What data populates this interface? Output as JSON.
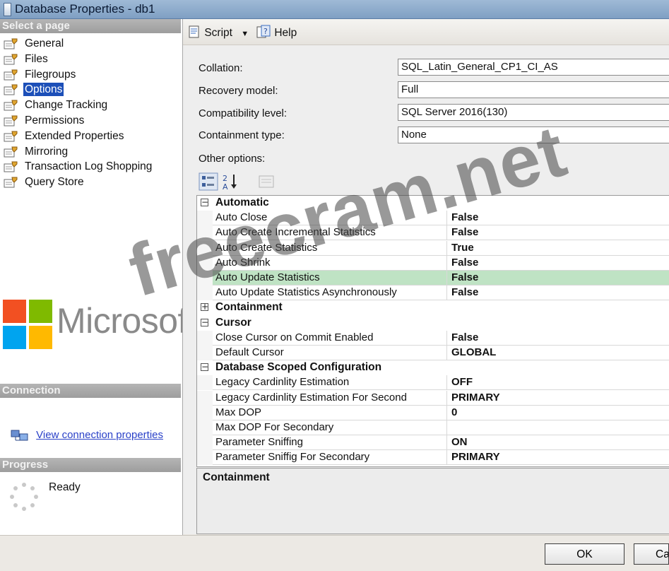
{
  "window": {
    "title": "Database Properties - db1"
  },
  "left_pane": {
    "select_page_header": "Select a page",
    "pages": [
      {
        "label": "General",
        "selected": false
      },
      {
        "label": "Files",
        "selected": false
      },
      {
        "label": "Filegroups",
        "selected": false
      },
      {
        "label": "Options",
        "selected": true
      },
      {
        "label": "Change Tracking",
        "selected": false
      },
      {
        "label": "Permissions",
        "selected": false
      },
      {
        "label": "Extended Properties",
        "selected": false
      },
      {
        "label": "Mirroring",
        "selected": false
      },
      {
        "label": "Transaction Log Shopping",
        "selected": false
      },
      {
        "label": "Query Store",
        "selected": false
      }
    ],
    "logo_text": "Microsoft",
    "logo_colors": [
      "#f25022",
      "#7fba00",
      "#00a4ef",
      "#ffb900"
    ],
    "connection_header": "Connection",
    "connection_link": "View connection properties",
    "progress_header": "Progress",
    "progress_status": "Ready"
  },
  "toolbar": {
    "script_label": "Script",
    "help_label": "Help"
  },
  "form": {
    "collation_label": "Collation:",
    "collation_value": "SQL_Latin_General_CP1_CI_AS",
    "recovery_label": "Recovery model:",
    "recovery_value": "Full",
    "compat_label": "Compatibility level:",
    "compat_value": "SQL Server 2016(130)",
    "containment_label": "Containment type:",
    "containment_value": "None",
    "other_options_label": "Other options:"
  },
  "grid": {
    "rows": [
      {
        "kind": "category",
        "label": "Automatic",
        "expanded": true
      },
      {
        "kind": "property",
        "name": "Auto Close",
        "value": "False"
      },
      {
        "kind": "property",
        "name": "Auto Create Incremental Statistics",
        "value": "False"
      },
      {
        "kind": "property",
        "name": "Auto Create Statistics",
        "value": "True"
      },
      {
        "kind": "property",
        "name": "Auto Shrink",
        "value": "False"
      },
      {
        "kind": "property",
        "name": "Auto Update Statistics",
        "value": "False",
        "highlight": true
      },
      {
        "kind": "property",
        "name": "Auto Update Statistics Asynchronously",
        "value": "False"
      },
      {
        "kind": "category",
        "label": "Containment",
        "expanded": false
      },
      {
        "kind": "category",
        "label": "Cursor",
        "expanded": true
      },
      {
        "kind": "property",
        "name": "Close Cursor on Commit Enabled",
        "value": "False"
      },
      {
        "kind": "property",
        "name": "Default Cursor",
        "value": "GLOBAL"
      },
      {
        "kind": "category",
        "label": "Database Scoped Configuration",
        "expanded": true
      },
      {
        "kind": "property",
        "name": "Legacy Cardinlity Estimation",
        "value": "OFF"
      },
      {
        "kind": "property",
        "name": "Legacy Cardinlity Estimation For Second",
        "value": "PRIMARY"
      },
      {
        "kind": "property",
        "name": "Max DOP",
        "value": "0"
      },
      {
        "kind": "property",
        "name": "Max DOP For Secondary",
        "value": ""
      },
      {
        "kind": "property",
        "name": "Parameter Sniffing",
        "value": "ON"
      },
      {
        "kind": "property",
        "name": "Parameter Sniffig For Secondary",
        "value": "PRIMARY"
      }
    ],
    "highlight_color": "#bfe3c4"
  },
  "description": {
    "title": "Containment"
  },
  "buttons": {
    "ok": "OK",
    "cancel": "Cancel"
  },
  "watermark": "freecram.net"
}
